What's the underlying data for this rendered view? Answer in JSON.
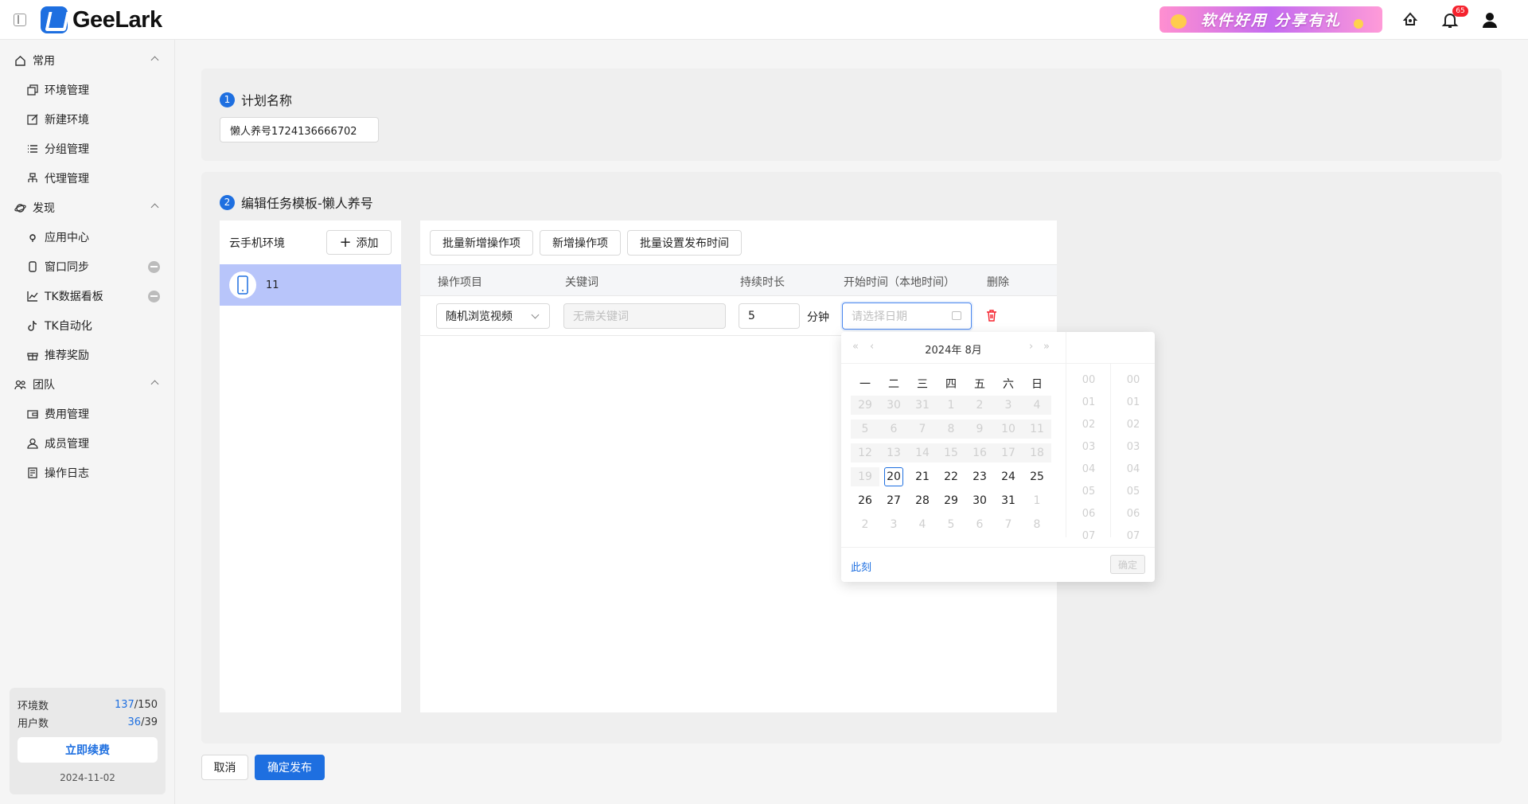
{
  "header": {
    "logo_text": "GeeLark",
    "promo_text": "软件好用 分享有礼",
    "notification_count": "65"
  },
  "sidebar": {
    "groups": [
      {
        "label": "常用",
        "items": [
          "环境管理",
          "新建环境",
          "分组管理",
          "代理管理"
        ]
      },
      {
        "label": "发现",
        "items": [
          "应用中心",
          "窗口同步",
          "TK数据看板",
          "TK自动化",
          "推荐奖励"
        ]
      },
      {
        "label": "团队",
        "items": [
          "费用管理",
          "成员管理",
          "操作日志"
        ]
      }
    ],
    "quota": {
      "env_label": "环境数",
      "env_used": "137",
      "env_total": "/150",
      "user_label": "用户数",
      "user_used": "36",
      "user_total": "/39",
      "renew_label": "立即续费",
      "expire_date": "2024-11-02"
    }
  },
  "plan": {
    "step1_num": "1",
    "step1_title": "计划名称",
    "name_value": "懒人养号1724136666702",
    "step2_num": "2",
    "step2_title": "编辑任务模板-懒人养号"
  },
  "env_panel": {
    "title": "云手机环境",
    "add_label": "添加",
    "rows": [
      "11"
    ]
  },
  "task_panel": {
    "buttons": [
      "批量新增操作项",
      "新增操作项",
      "批量设置发布时间"
    ],
    "columns": [
      "操作项目",
      "关键词",
      "持续时长",
      "开始时间（本地时间）",
      "删除"
    ],
    "row": {
      "operation": "随机浏览视频",
      "keyword_placeholder": "无需关键词",
      "duration": "5",
      "duration_unit": "分钟",
      "date_placeholder": "请选择日期"
    }
  },
  "date_picker": {
    "title": "2024年  8月",
    "weekdays": [
      "一",
      "二",
      "三",
      "四",
      "五",
      "六",
      "日"
    ],
    "weeks": [
      [
        "29",
        "30",
        "31",
        "1",
        "2",
        "3",
        "4"
      ],
      [
        "5",
        "6",
        "7",
        "8",
        "9",
        "10",
        "11"
      ],
      [
        "12",
        "13",
        "14",
        "15",
        "16",
        "17",
        "18"
      ],
      [
        "19",
        "20",
        "21",
        "22",
        "23",
        "24",
        "25"
      ],
      [
        "26",
        "27",
        "28",
        "29",
        "30",
        "31",
        "1"
      ],
      [
        "2",
        "3",
        "4",
        "5",
        "6",
        "7",
        "8"
      ]
    ],
    "today": "20",
    "hours": [
      "00",
      "01",
      "02",
      "03",
      "04",
      "05",
      "06",
      "07"
    ],
    "minutes": [
      "00",
      "01",
      "02",
      "03",
      "04",
      "05",
      "06",
      "07"
    ],
    "now_label": "此刻",
    "ok_label": "确定"
  },
  "footer": {
    "cancel_label": "取消",
    "publish_label": "确定发布"
  },
  "colors": {
    "primary": "#1e6fe0",
    "selected_row": "#b8c5fa",
    "danger": "#f5222d"
  }
}
